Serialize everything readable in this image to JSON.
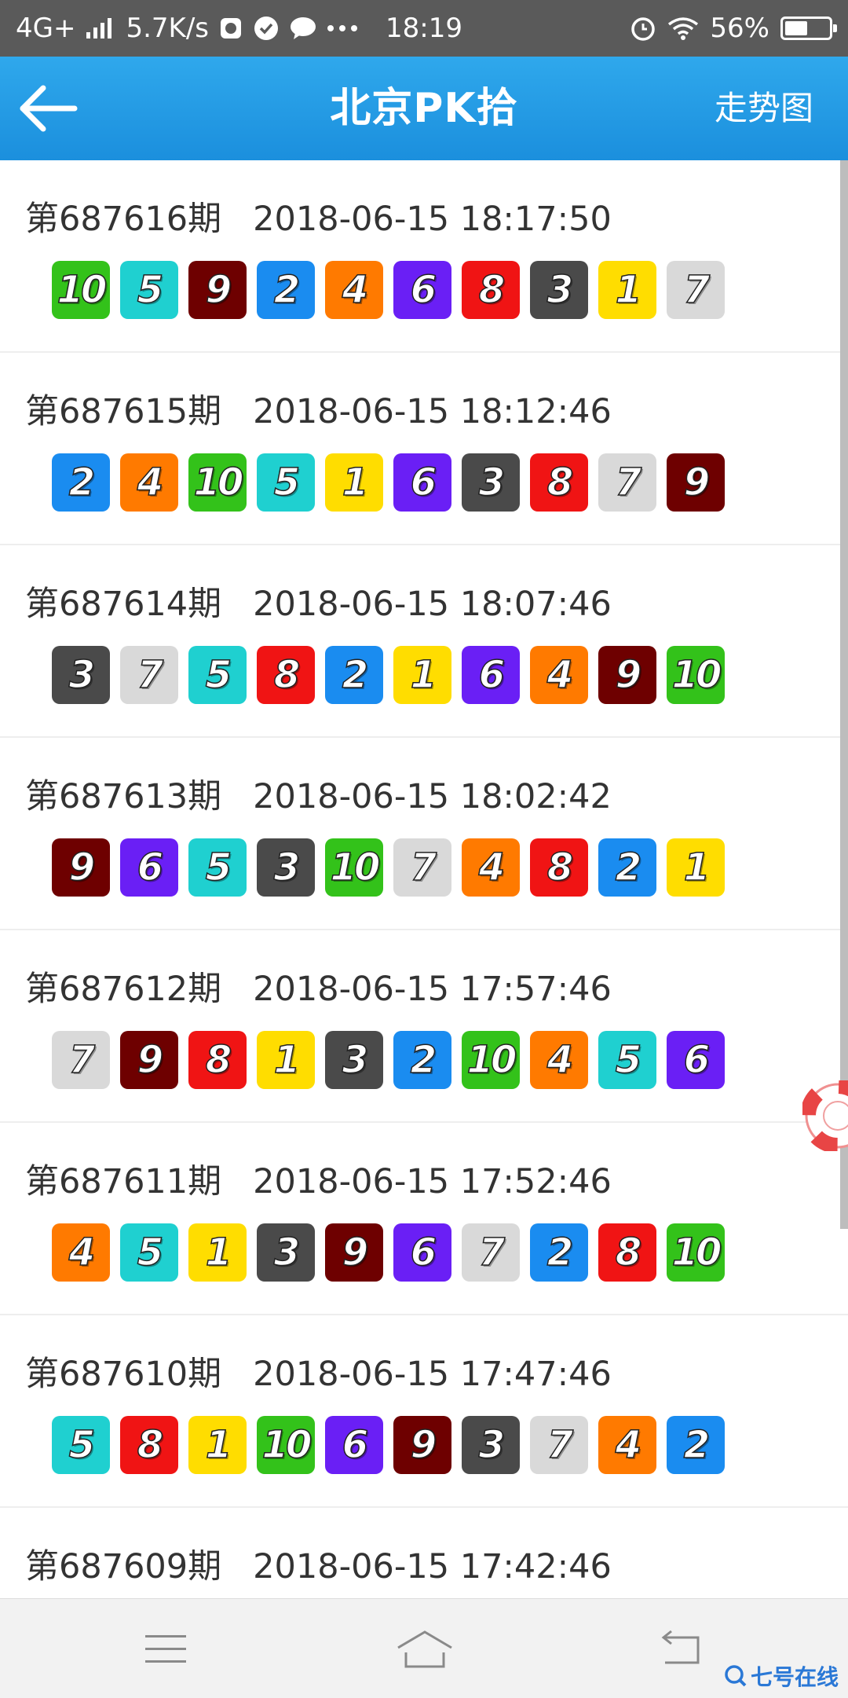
{
  "status_bar": {
    "network": "4G+",
    "speed": "5.7K/s",
    "time": "18:19",
    "battery": "56%",
    "battery_level": 0.56
  },
  "header": {
    "title": "北京PK拾",
    "trend_link": "走势图"
  },
  "colors": {
    "1": "#ffdd00",
    "2": "#1a8cf0",
    "3": "#4a4a4a",
    "4": "#ff7a00",
    "5": "#1fd0d0",
    "6": "#6a1ff5",
    "7": "#d9d9d9",
    "8": "#f01414",
    "9": "#6e0000",
    "10": "#33c21a"
  },
  "draws": [
    {
      "issue": "第687616期",
      "time": "2018-06-15 18:17:50",
      "numbers": [
        10,
        5,
        9,
        2,
        4,
        6,
        8,
        3,
        1,
        7
      ]
    },
    {
      "issue": "第687615期",
      "time": "2018-06-15 18:12:46",
      "numbers": [
        2,
        4,
        10,
        5,
        1,
        6,
        3,
        8,
        7,
        9
      ]
    },
    {
      "issue": "第687614期",
      "time": "2018-06-15 18:07:46",
      "numbers": [
        3,
        7,
        5,
        8,
        2,
        1,
        6,
        4,
        9,
        10
      ]
    },
    {
      "issue": "第687613期",
      "time": "2018-06-15 18:02:42",
      "numbers": [
        9,
        6,
        5,
        3,
        10,
        7,
        4,
        8,
        2,
        1
      ]
    },
    {
      "issue": "第687612期",
      "time": "2018-06-15 17:57:46",
      "numbers": [
        7,
        9,
        8,
        1,
        3,
        2,
        10,
        4,
        5,
        6
      ]
    },
    {
      "issue": "第687611期",
      "time": "2018-06-15 17:52:46",
      "numbers": [
        4,
        5,
        1,
        3,
        9,
        6,
        7,
        2,
        8,
        10
      ]
    },
    {
      "issue": "第687610期",
      "time": "2018-06-15 17:47:46",
      "numbers": [
        5,
        8,
        1,
        10,
        6,
        9,
        3,
        7,
        4,
        2
      ]
    },
    {
      "issue": "第687609期",
      "time": "2018-06-15 17:42:46",
      "numbers": []
    }
  ],
  "watermark": "七号在线"
}
